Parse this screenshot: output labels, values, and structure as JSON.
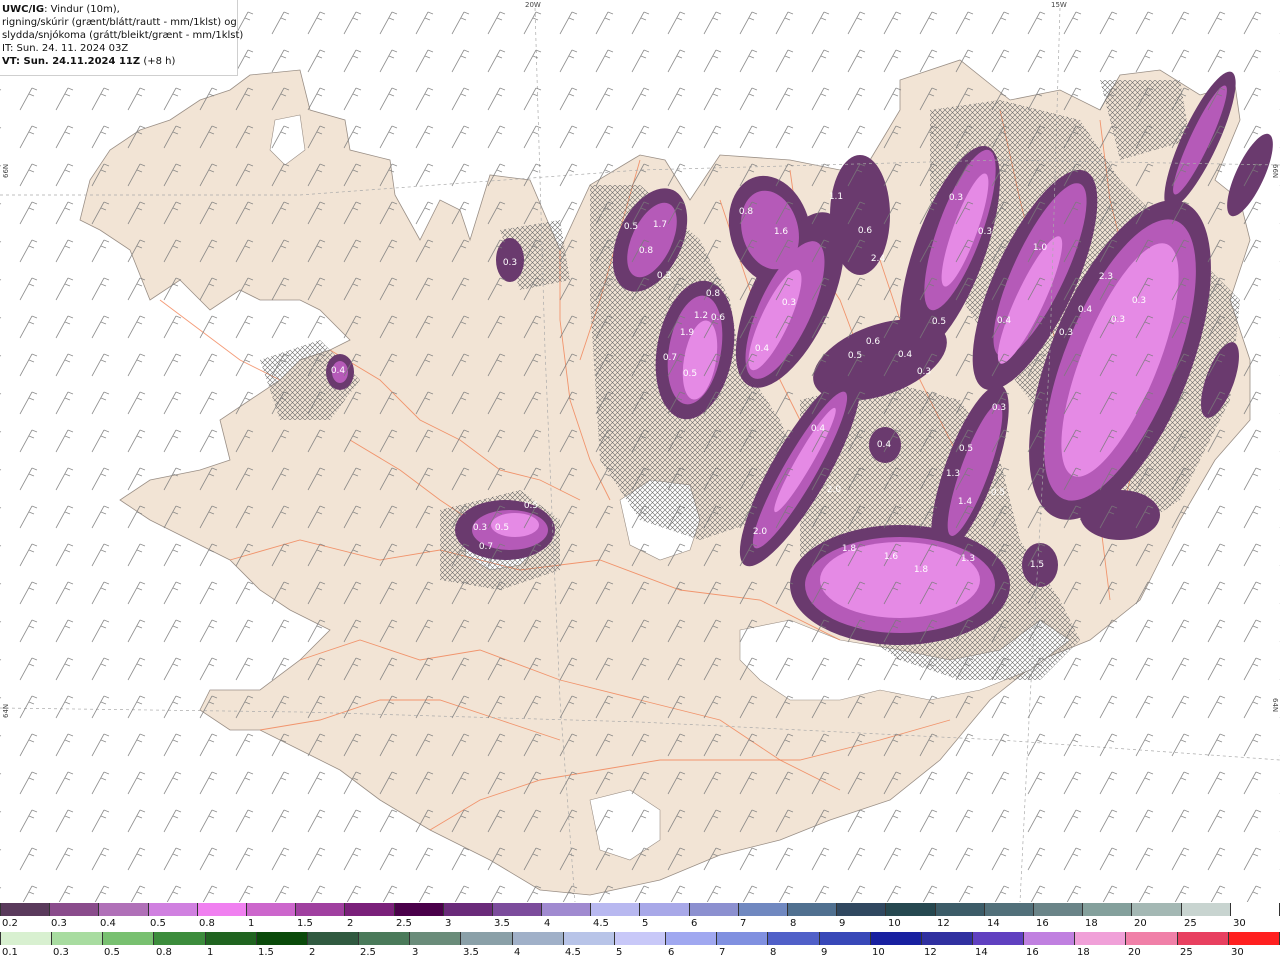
{
  "header": {
    "product": "UWC/IG",
    "line1_rest": ": Vindur (10m),",
    "line2": "rigning/skúrir (grænt/blátt/rautt - mm/1klst) og",
    "line3": "slydda/snjókoma (grátt/bleikt/grænt - mm/1klst)",
    "initial_time": "IT: Sun. 24. 11. 2024 03Z",
    "valid_time": "VT: Sun. 24.11.2024 11Z",
    "lead": "(+8 h)"
  },
  "graticule": {
    "lon_20w": "20W",
    "lon_15w": "15W",
    "lat_66n_left": "66N",
    "lat_66n_right": "66N",
    "lat_64n_left": "64N",
    "lat_64n_right": "64N"
  },
  "colors": {
    "land": "#f2e4d5",
    "land_edge": "#9a8f86",
    "glacier": "#ffffff",
    "roads": "#f07a4a",
    "snow_light": "#e58ae5",
    "snow_mid": "#b55ab8",
    "snow_dark": "#6a3a6e"
  },
  "precip_labels": [
    {
      "text": "0.3"
    },
    {
      "text": "0.4"
    },
    {
      "text": "0.3"
    },
    {
      "text": "0.5"
    },
    {
      "text": "0.5"
    },
    {
      "text": "0.7"
    },
    {
      "text": "0.8"
    },
    {
      "text": "1.7"
    },
    {
      "text": "0.5"
    },
    {
      "text": "0.3"
    },
    {
      "text": "0.8"
    },
    {
      "text": "1.6"
    },
    {
      "text": "1.1"
    },
    {
      "text": "0.6"
    },
    {
      "text": "0.8"
    },
    {
      "text": "0.6"
    },
    {
      "text": "1.2"
    },
    {
      "text": "1.9"
    },
    {
      "text": "0.7"
    },
    {
      "text": "0.5"
    },
    {
      "text": "0.3"
    },
    {
      "text": "0.4"
    },
    {
      "text": "0.5"
    },
    {
      "text": "0.6"
    },
    {
      "text": "0.4"
    },
    {
      "text": "0.3"
    },
    {
      "text": "0.4"
    },
    {
      "text": "0.4"
    },
    {
      "text": "0.3"
    },
    {
      "text": "0.5"
    },
    {
      "text": "0.3"
    },
    {
      "text": "0.3"
    },
    {
      "text": "0.5"
    },
    {
      "text": "0.4"
    },
    {
      "text": "1.0"
    },
    {
      "text": "2.4"
    },
    {
      "text": "1.3"
    },
    {
      "text": "1.4"
    },
    {
      "text": "0.5"
    },
    {
      "text": "2.0"
    },
    {
      "text": "2.0"
    },
    {
      "text": "1.8"
    },
    {
      "text": "1.6"
    },
    {
      "text": "1.8"
    },
    {
      "text": "1.3"
    },
    {
      "text": "1.5"
    },
    {
      "text": "2.3"
    },
    {
      "text": "0.3"
    },
    {
      "text": "0.4"
    },
    {
      "text": "0.3"
    },
    {
      "text": "0.3"
    }
  ],
  "legend_snow": {
    "labels": [
      "0.2",
      "0.3",
      "0.4",
      "0.5",
      "0.8",
      "1",
      "1.5",
      "2",
      "2.5",
      "3",
      "3.5",
      "4",
      "4.5",
      "5",
      "6",
      "7",
      "8",
      "9",
      "10",
      "12",
      "14",
      "16",
      "18",
      "20",
      "25",
      "30"
    ],
    "colors": [
      "#5a3a5c",
      "#8a4c8c",
      "#b070b8",
      "#d080e0",
      "#f080f0",
      "#cc66cc",
      "#a040a0",
      "#7a207a",
      "#4a004a",
      "#6a2a7a",
      "#7c4c9c",
      "#a08ad0",
      "#b8b8f0",
      "#a8a8e8",
      "#8c90d0",
      "#7088c0",
      "#507090",
      "#304860",
      "#264850",
      "#3c5c68",
      "#52707a",
      "#6a8488",
      "#84a09c",
      "#a4b8b4",
      "#c8d4d0",
      "#ffffff"
    ]
  },
  "legend_rain": {
    "labels": [
      "0.1",
      "0.3",
      "0.5",
      "0.8",
      "1",
      "1.5",
      "2",
      "2.5",
      "3",
      "3.5",
      "4",
      "4.5",
      "5",
      "6",
      "7",
      "8",
      "9",
      "10",
      "12",
      "14",
      "16",
      "18",
      "20",
      "25",
      "30"
    ],
    "colors": [
      "#d8f0d0",
      "#a8dca0",
      "#78c070",
      "#3c8c3c",
      "#206420",
      "#0a4a0a",
      "#305a40",
      "#4a7a5a",
      "#6a8c7a",
      "#8aa0a8",
      "#a0b0c8",
      "#b8c4e8",
      "#c8c8f8",
      "#a0a8f0",
      "#8090e0",
      "#5060c8",
      "#3848b8",
      "#1820a0",
      "#3030a0",
      "#6040c0",
      "#c080e0",
      "#f0a0d8",
      "#f080a8",
      "#e84060",
      "#ff2020"
    ]
  }
}
